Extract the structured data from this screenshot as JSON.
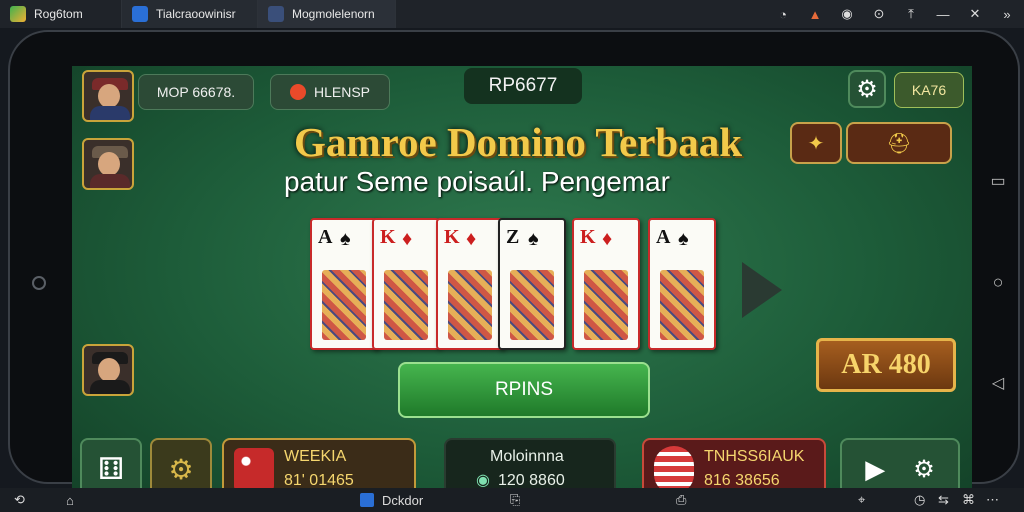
{
  "tabs": [
    {
      "label": "Rog6tom"
    },
    {
      "label": "Tialcraoowinisr"
    },
    {
      "label": "Mogmolelenorn"
    }
  ],
  "hud": {
    "player_score": "MOP 66678.",
    "hud_chip_label": "HLENSP",
    "balance": "RP6677",
    "top_right_badge": "KA76"
  },
  "title": "Gamroe Domino Terbaak",
  "subtitle": "patur Seme poisaúl. Pengemar",
  "cards": [
    {
      "rank": "A",
      "suit": "♠",
      "color": "#111111"
    },
    {
      "rank": "K",
      "suit": "♦",
      "color": "#cc1f1f"
    },
    {
      "rank": "K",
      "suit": "♦",
      "color": "#cc1f1f"
    },
    {
      "rank": "Z",
      "suit": "♠",
      "color": "#111111"
    },
    {
      "rank": "K",
      "suit": "♦",
      "color": "#cc1f1f"
    },
    {
      "rank": "A",
      "suit": "♠",
      "color": "#111111"
    }
  ],
  "spin_label": "RPINS",
  "ar_value": "AR 480",
  "stats": {
    "weekly": {
      "line1": "WEEKIA",
      "line2": "81' 01465"
    },
    "center": {
      "line1": "Moloinnna",
      "line2": "120 8860"
    },
    "right": {
      "line1": "TNHSS6IAUK",
      "line2": "816 38656"
    }
  },
  "bottom": {
    "dock_label": "Dckdor"
  },
  "colors": {
    "felt": "#1d5c39",
    "gold": "#f2c94a",
    "spin_green": "#2f9a3a"
  }
}
